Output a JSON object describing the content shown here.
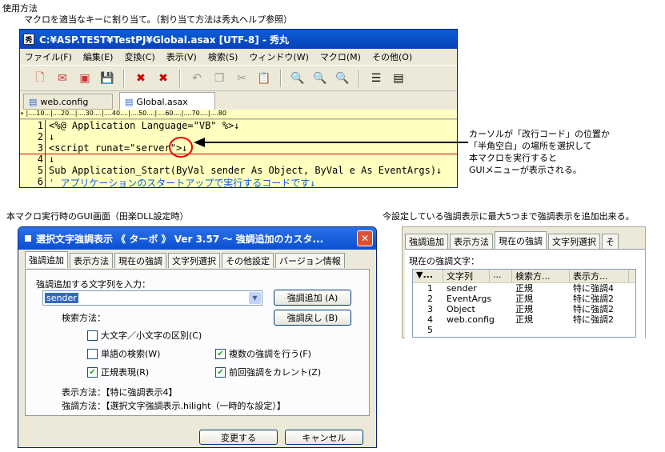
{
  "heading": "使用方法",
  "instruction": "マクロを適当なキーに割り当て。（割り当て方法は秀丸ヘルプ参照）",
  "editor": {
    "title": "C:¥ASP.TEST¥TestPJ¥Global.asax  [UTF-8] - 秀丸",
    "menu": [
      "ファイル(F)",
      "編集(E)",
      "変換(C)",
      "表示(V)",
      "検索(S)",
      "ウィンドウ(W)",
      "マクロ(M)",
      "その他(O)"
    ],
    "tabs": [
      "web.config",
      "Global.asax"
    ],
    "ruler": "»  |....10...|....20...|....30....|....40....|....50....|....60....|....70....|....80",
    "lines": [
      {
        "n": "1",
        "text": "<%@ Application Language=\"VB\" %>↓"
      },
      {
        "n": "2",
        "text": "↓"
      },
      {
        "n": "3",
        "text": "<script runat=\"server\">↓"
      },
      {
        "n": "4",
        "text": "↓"
      },
      {
        "n": "5",
        "text": "    Sub Application_Start(ByVal sender As Object, ByVal e As EventArgs)↓"
      },
      {
        "n": "6",
        "text": "        ' アプリケーションのスタートアップで実行するコードです↓"
      }
    ]
  },
  "annotation": [
    "カーソルが「改行コード」の位置か",
    "「半角空白」の場所を選択して",
    "本マクロを実行すると",
    "GUIメニューが表示される。"
  ],
  "gui_caption": "本マクロ実行時のGUI画面（田楽DLL設定時）",
  "right_caption": "今設定している強調表示に最大5つまで強調表示を追加出来る。",
  "dialog": {
    "title": "選択文字強調表示 《 ターボ 》 Ver 3.57  ～ 強調追加のカスタ...",
    "close": "✕",
    "tabs": [
      "強調追加",
      "表示方法",
      "現在の強調",
      "文字列選択",
      "その他設定",
      "バージョン情報"
    ],
    "input_label": "強調追加する文字列を入力：",
    "input_value": "sender",
    "add_button": "強調追加 (A)",
    "undo_button": "強調戻し (B)",
    "search_label": "検索方法：",
    "checks": [
      {
        "label": "大文字／小文字の区別(C)",
        "checked": false
      },
      {
        "label": "単語の検索(W)",
        "checked": false
      },
      {
        "label": "複数の強調を行う(F)",
        "checked": true
      },
      {
        "label": "正規表現(R)",
        "checked": true
      },
      {
        "label": "前回強調をカレント(Z)",
        "checked": true
      }
    ],
    "display_method": "表示方法：【特に強調表示4】",
    "highlight_method": "強調方法：【選択文字強調表示.hilight（一時的な設定）】",
    "ok": "変更する",
    "cancel": "キャンセル"
  },
  "right_panel": {
    "tabs": [
      "強調追加",
      "表示方法",
      "現在の強調",
      "文字列選択",
      "そ"
    ],
    "label": "現在の強調文字：",
    "headers": [
      "▼...",
      "文字列",
      "...",
      "検索方...",
      "表示方..."
    ],
    "rows": [
      [
        "1",
        "sender",
        "正規",
        "特に強調4"
      ],
      [
        "2",
        "EventArgs",
        "正規",
        "特に強調2"
      ],
      [
        "3",
        "Object",
        "正規",
        "特に強調2"
      ],
      [
        "4",
        "web.config",
        "正規",
        "特に強調2"
      ],
      [
        "5",
        "",
        "",
        ""
      ]
    ]
  }
}
